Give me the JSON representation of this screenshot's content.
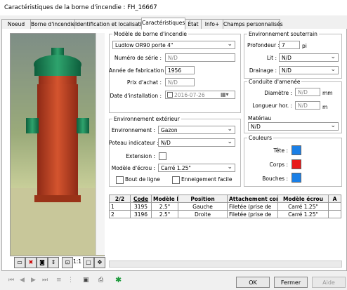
{
  "window": {
    "title": "Caractéristiques de la borne d'incendie : FH_16667"
  },
  "tabs": [
    "Noeud",
    "Borne d'incendie",
    "Identification et localisation",
    "Caractéristiques",
    "État",
    "Info+",
    "Champs personnalisés"
  ],
  "active_tab": "Caractéristiques",
  "image_toolbar": {
    "ratio_label": "1:1"
  },
  "model_section": {
    "legend": "Modèle de borne d'incendie",
    "model_value": "Ludlow OR90 porte 4\"",
    "serial_label": "Numéro de série :",
    "serial_value": "N/D",
    "year_label": "Année de fabrication :",
    "year_value": "1956",
    "price_label": "Prix d'achat :",
    "price_value": "N/D",
    "install_label": "Date d'installation :",
    "install_value": "2016-07-26"
  },
  "underground": {
    "legend": "Environnement souterrain",
    "depth_label": "Profondeur :",
    "depth_value": "7",
    "depth_unit": "pi",
    "bed_label": "Lit :",
    "bed_value": "N/D",
    "drainage_label": "Drainage :",
    "drainage_value": "N/D"
  },
  "supply": {
    "legend": "Conduite d'amenée",
    "diameter_label": "Diamètre :",
    "diameter_value": "N/D",
    "diameter_unit": "mm",
    "length_label": "Longueur hor. :",
    "length_value": "N/D",
    "length_unit": "m",
    "material_label": "Matériau",
    "material_value": "N/D"
  },
  "exterior": {
    "legend": "Environnement extérieur",
    "env_label": "Environnement :",
    "env_value": "Gazon",
    "post_label": "Poteau indicateur :",
    "post_value": "N/D",
    "extension_label": "Extension :",
    "nut_label": "Modèle d'écrou :",
    "nut_value": "Carré 1.25\"",
    "endline_label": "Bout de ligne",
    "snow_label": "Enneigement facile"
  },
  "colors": {
    "legend": "Couleurs",
    "head_label": "Tête :",
    "head_color": "#1a7fe6",
    "body_label": "Corps :",
    "body_color": "#e81818",
    "caps_label": "Bouches :",
    "caps_color": "#1a7fe6"
  },
  "outlets_table": {
    "columns": [
      "2/2",
      "Code",
      "Modèle b",
      "Position",
      "Attachement cor",
      "Modèle écrou",
      "A"
    ],
    "rows": [
      [
        "1",
        "3195",
        "2.5\"",
        "Gauche",
        "Filetée (prise de",
        "Carré 1.25\"",
        ""
      ],
      [
        "2",
        "3196",
        "2.5\"",
        "Droite",
        "Filetée (prise de",
        "Carré 1.25\"",
        ""
      ]
    ]
  },
  "buttons": {
    "ok": "OK",
    "close": "Fermer",
    "help": "Aide"
  }
}
